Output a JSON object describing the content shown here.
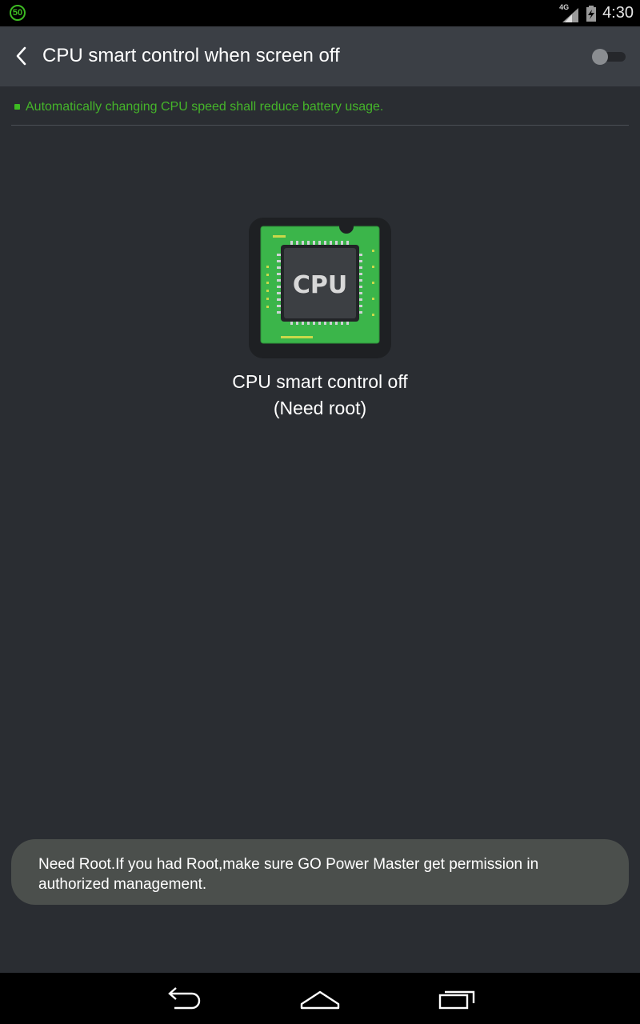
{
  "status_bar": {
    "badge_text": "50",
    "network_label": "4G",
    "time": "4:30",
    "colors": {
      "badge": "#3dba22"
    }
  },
  "header": {
    "back_icon": "chevron-left-icon",
    "title": "CPU smart control when screen off",
    "toggle_state": "off"
  },
  "info": {
    "text": "Automatically changing CPU speed shall reduce battery usage.",
    "accent": "#45b52a"
  },
  "main": {
    "chip_label": "CPU",
    "status_title": "CPU smart control off",
    "status_sub": "(Need root)"
  },
  "toast": {
    "message": "Need Root.If you had Root,make sure GO Power Master get permission in authorized management."
  },
  "nav": {
    "icons": [
      "back-icon",
      "home-icon",
      "recents-icon"
    ]
  }
}
